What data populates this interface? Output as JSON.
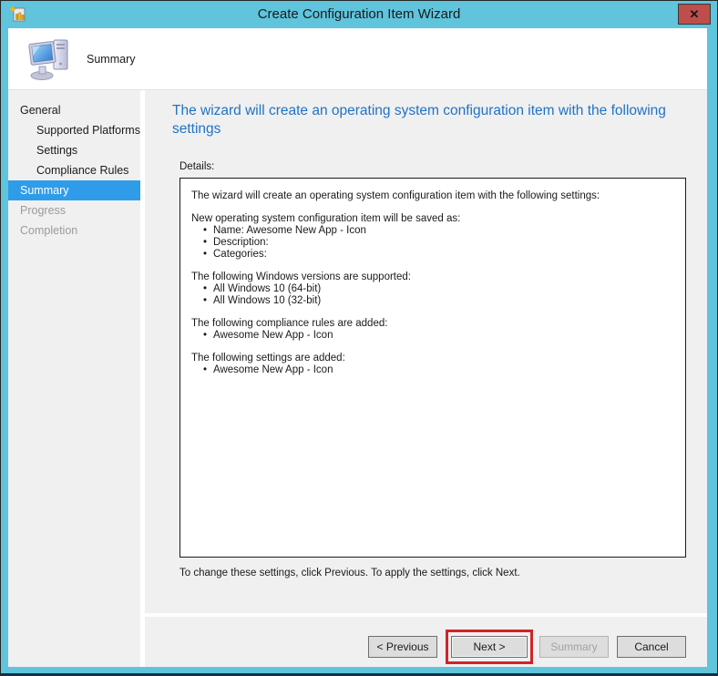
{
  "window": {
    "title": "Create Configuration Item Wizard",
    "close_glyph": "✕"
  },
  "header": {
    "step_title": "Summary"
  },
  "icons": {
    "titlebar": "configuration-item-icon",
    "header": "computer-icon",
    "close": "close-icon"
  },
  "colors": {
    "titlebar_teal": "#5FC4DC",
    "active_nav_blue": "#2F9CE9",
    "heading_blue": "#2173C4",
    "close_button_red": "#BE4E4B",
    "annotation_red": "#D0242A",
    "panel_gray": "#F0F0F0"
  },
  "sidebar": {
    "items": [
      {
        "label": "General",
        "indent": false,
        "state": "enabled"
      },
      {
        "label": "Supported Platforms",
        "indent": true,
        "state": "enabled"
      },
      {
        "label": "Settings",
        "indent": true,
        "state": "enabled"
      },
      {
        "label": "Compliance Rules",
        "indent": true,
        "state": "enabled"
      },
      {
        "label": "Summary",
        "indent": false,
        "state": "active"
      },
      {
        "label": "Progress",
        "indent": false,
        "state": "disabled"
      },
      {
        "label": "Completion",
        "indent": false,
        "state": "disabled"
      }
    ]
  },
  "main": {
    "heading": "The wizard will create an operating system configuration item with the following settings",
    "details_label": "Details:",
    "details": {
      "intro": "The wizard will create an operating system configuration item with the following settings:",
      "sections": [
        {
          "heading": "New operating system configuration item will be saved as:",
          "bullets": [
            "Name: Awesome New App - Icon",
            "Description:",
            "Categories:"
          ]
        },
        {
          "heading": "The following Windows versions are supported:",
          "bullets": [
            "All Windows 10 (64-bit)",
            "All Windows 10 (32-bit)"
          ]
        },
        {
          "heading": "The following compliance rules are added:",
          "bullets": [
            "Awesome New App - Icon"
          ]
        },
        {
          "heading": "The following settings are added:",
          "bullets": [
            "Awesome New App - Icon"
          ]
        }
      ]
    },
    "footer_note": "To change these settings, click Previous. To apply the settings, click Next."
  },
  "buttons": {
    "previous": "< Previous",
    "next": "Next >",
    "summary": "Summary",
    "cancel": "Cancel"
  },
  "annotation": {
    "target": "next-button",
    "color": "#D0242A"
  }
}
